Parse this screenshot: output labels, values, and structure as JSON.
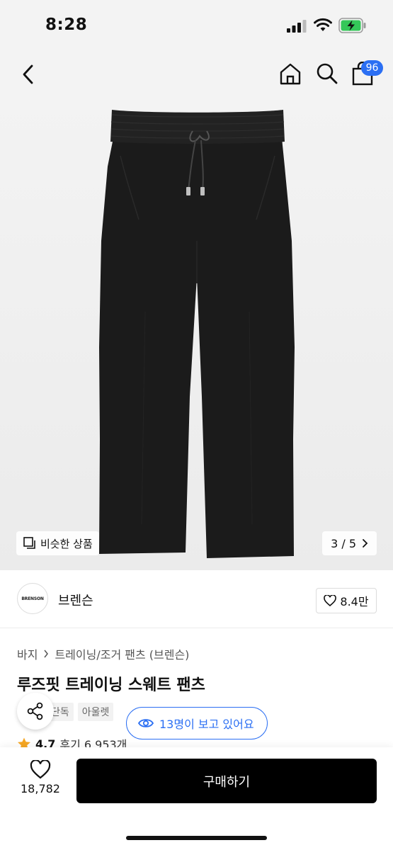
{
  "status_bar": {
    "time": "8:28"
  },
  "nav": {
    "cart_count": "96"
  },
  "gallery": {
    "similar_label": "비슷한 상품",
    "counter": "3 / 5"
  },
  "brand": {
    "logo_text": "BRENSON",
    "name": "브렌슨",
    "likes": "8.4만"
  },
  "product": {
    "breadcrumb": [
      "바지",
      "트레이닝/조거 팬츠 (브렌슨)"
    ],
    "title": "루즈핏 트레이닝 스웨트 팬츠",
    "tags": [
      "단독",
      "아울렛"
    ],
    "viewing": "13명이 보고 있어요",
    "rating": "4.7",
    "reviews": "후기 6,953개"
  },
  "bottom": {
    "wish_count": "18,782",
    "buy_label": "구매하기"
  },
  "colors": {
    "accent": "#2b6ff3",
    "buy_button": "#000000",
    "star": "#f5a623"
  }
}
